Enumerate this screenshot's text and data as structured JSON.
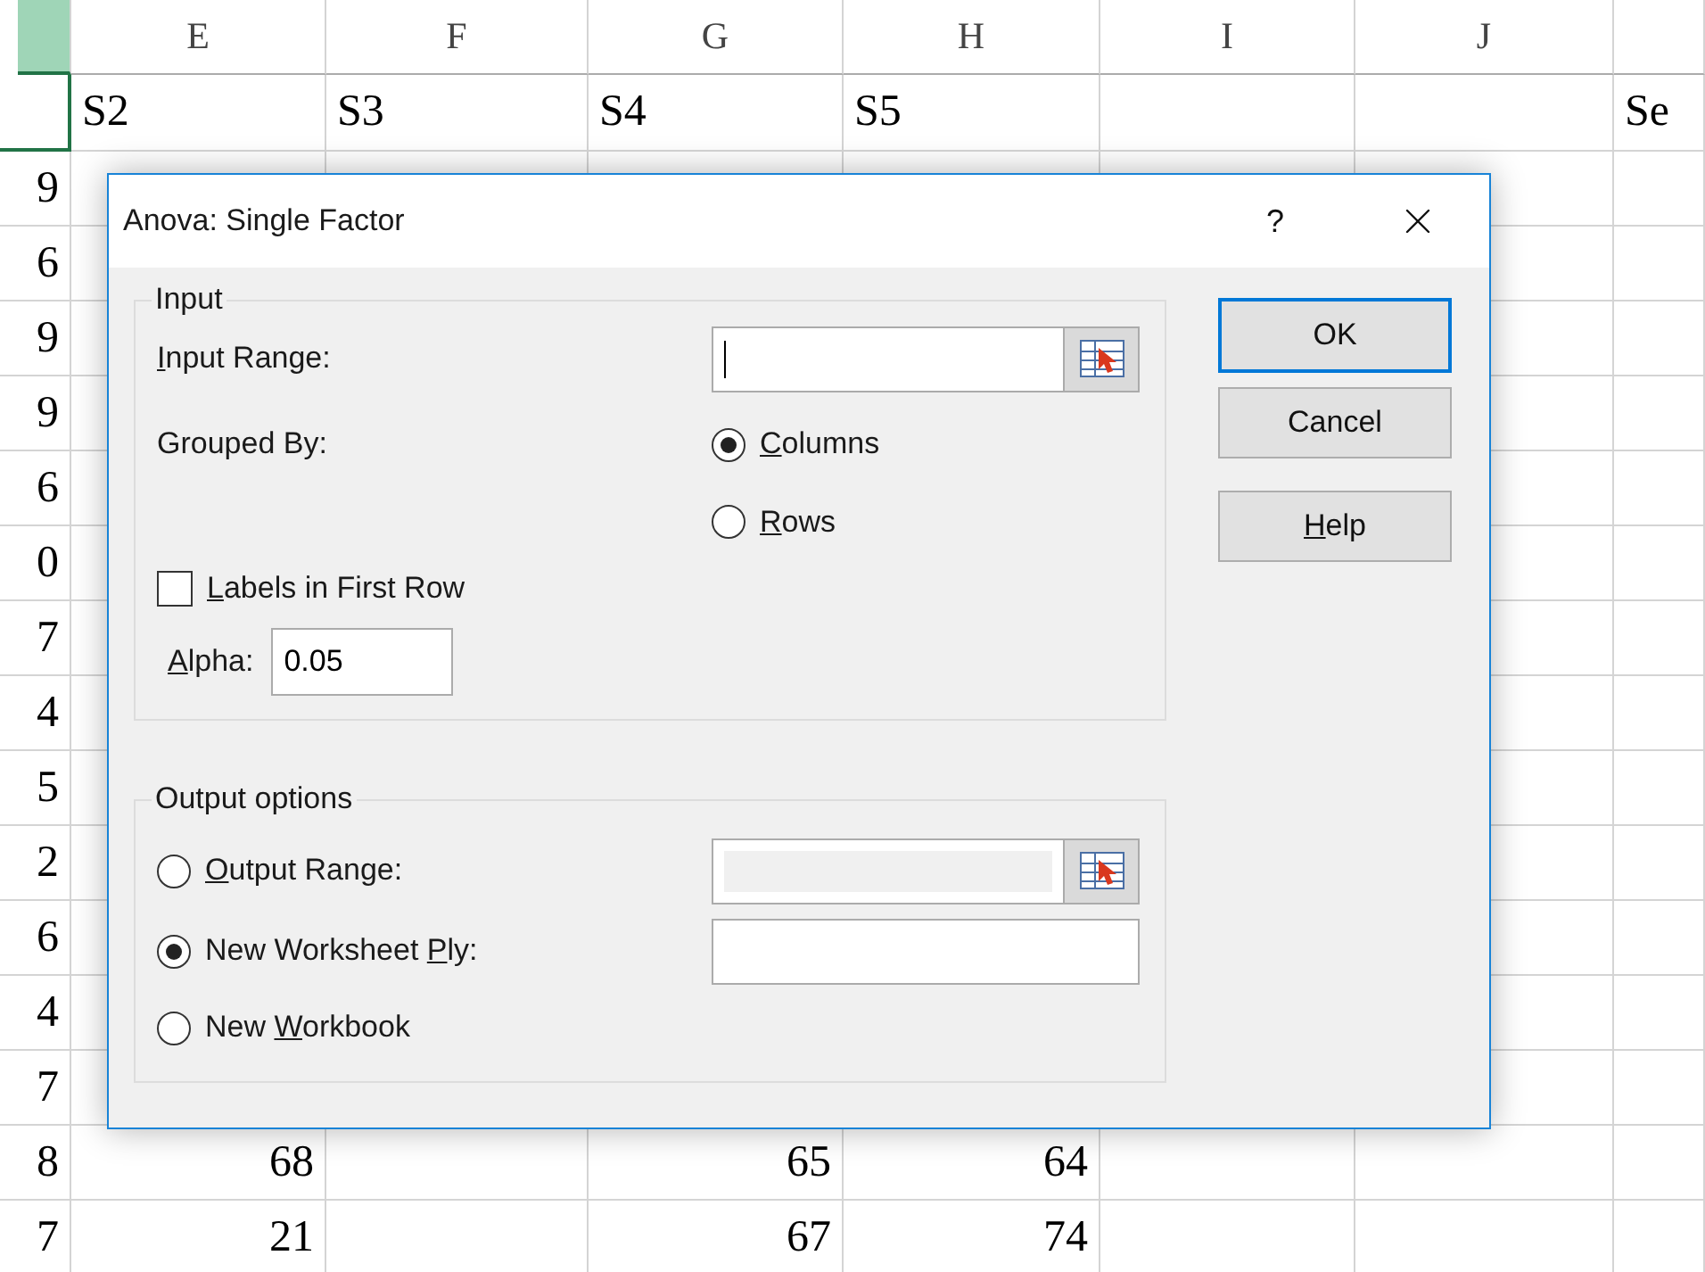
{
  "sheet": {
    "columns": [
      {
        "selected": true
      },
      {
        "label": "E",
        "selected": false
      },
      {
        "label": "F",
        "selected": false
      },
      {
        "label": "G",
        "selected": false
      },
      {
        "label": "H",
        "selected": false
      },
      {
        "label": "I",
        "selected": false
      },
      {
        "label": "J",
        "selected": false
      },
      {
        "selected": false
      }
    ],
    "rows": [
      {
        "kind": "labels",
        "selected": true,
        "cells": [
          null,
          "S2",
          "S3",
          "S4",
          "S5",
          null,
          null,
          "Se"
        ]
      },
      {
        "kind": "values",
        "selected": false,
        "cells": [
          "9",
          null,
          null,
          null,
          null,
          null,
          null,
          null
        ]
      },
      {
        "kind": "values",
        "selected": false,
        "cells": [
          "6",
          null,
          null,
          null,
          null,
          null,
          null,
          null
        ]
      },
      {
        "kind": "values",
        "selected": false,
        "cells": [
          "9",
          null,
          null,
          null,
          null,
          null,
          null,
          null
        ]
      },
      {
        "kind": "values",
        "selected": false,
        "cells": [
          "9",
          null,
          null,
          null,
          null,
          null,
          null,
          null
        ]
      },
      {
        "kind": "values",
        "selected": false,
        "cells": [
          "6",
          null,
          null,
          null,
          null,
          null,
          null,
          null
        ]
      },
      {
        "kind": "values",
        "selected": false,
        "cells": [
          "0",
          null,
          null,
          null,
          null,
          null,
          null,
          null
        ]
      },
      {
        "kind": "values",
        "selected": false,
        "cells": [
          "7",
          null,
          null,
          null,
          null,
          null,
          null,
          null
        ]
      },
      {
        "kind": "values",
        "selected": false,
        "cells": [
          "4",
          null,
          null,
          null,
          null,
          null,
          null,
          null
        ]
      },
      {
        "kind": "values",
        "selected": false,
        "cells": [
          "5",
          null,
          null,
          null,
          null,
          null,
          null,
          null
        ]
      },
      {
        "kind": "values",
        "selected": false,
        "cells": [
          "2",
          null,
          null,
          null,
          null,
          null,
          null,
          null
        ]
      },
      {
        "kind": "values",
        "selected": false,
        "cells": [
          "6",
          null,
          null,
          null,
          null,
          null,
          null,
          null
        ]
      },
      {
        "kind": "values",
        "selected": false,
        "cells": [
          "4",
          null,
          null,
          null,
          null,
          null,
          null,
          null
        ]
      },
      {
        "kind": "values",
        "selected": false,
        "cells": [
          "7",
          null,
          null,
          null,
          null,
          null,
          null,
          null
        ]
      },
      {
        "kind": "values",
        "selected": false,
        "cells": [
          "8",
          "68",
          null,
          "65",
          "64",
          null,
          null,
          null
        ]
      },
      {
        "kind": "values",
        "selected": false,
        "cells": [
          "7",
          "21",
          null,
          "67",
          "74",
          null,
          null,
          null
        ]
      }
    ]
  },
  "dialog": {
    "title": "Anova: Single Factor",
    "help_button": "?",
    "input": {
      "legend": "Input",
      "range": {
        "label": {
          "key": "I",
          "after": "nput Range:"
        },
        "focused": true
      },
      "grouped_by": {
        "label": "Grouped By:",
        "options": [
          {
            "label": {
              "key": "C",
              "after": "olumns"
            },
            "selected": true
          },
          {
            "label": {
              "key": "R",
              "after": "ows"
            },
            "selected": false
          }
        ]
      },
      "labels_checkbox": {
        "label": {
          "key": "L",
          "after": "abels in First Row"
        },
        "checked": false
      },
      "alpha": {
        "label": {
          "key": "A",
          "after": "lpha:"
        },
        "value": "0.05"
      }
    },
    "output": {
      "legend": "Output options",
      "options": [
        {
          "label": {
            "key": "O",
            "after": "utput Range:"
          },
          "selected": false,
          "field": {
            "disabled": true,
            "picker": true
          }
        },
        {
          "label": {
            "before": "New Worksheet ",
            "key": "P",
            "after": "ly:"
          },
          "selected": true,
          "field": {
            "disabled": false
          }
        },
        {
          "label": {
            "before": "New ",
            "key": "W",
            "after": "orkbook"
          },
          "selected": false
        }
      ]
    },
    "buttons": [
      {
        "label": {
          "after": "OK"
        },
        "default": true
      },
      {
        "label": {
          "after": "Cancel"
        },
        "default": false
      },
      {
        "label": {
          "key": "H",
          "after": "elp"
        },
        "default": false
      }
    ]
  }
}
